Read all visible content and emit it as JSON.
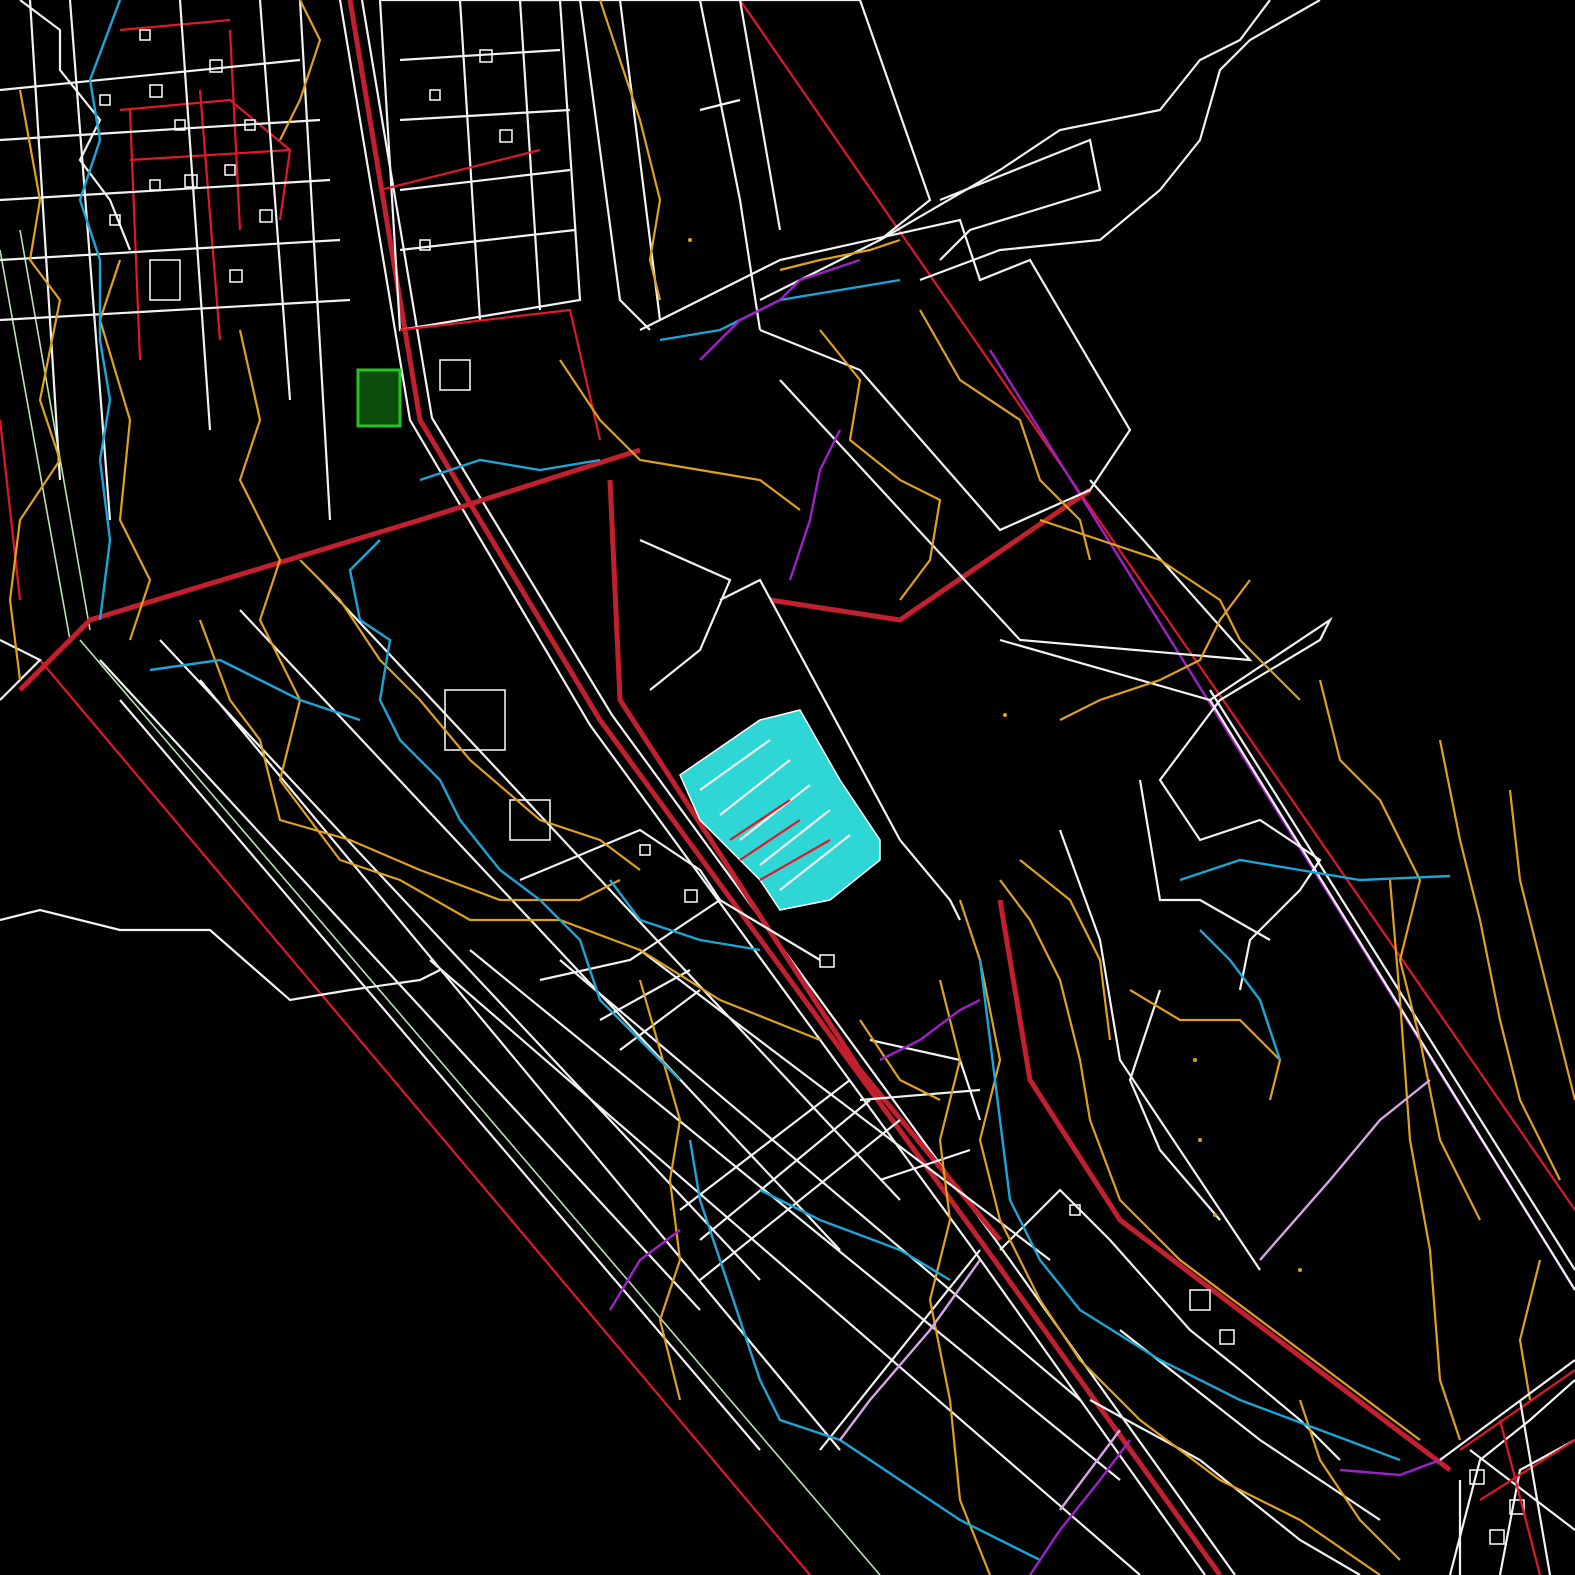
{
  "drawing": {
    "background": "#000000",
    "layer_colors": {
      "parcel_boundary": "#f2f2f2",
      "road_red": "#e0182a",
      "contour_orange": "#e0a11b",
      "water_blue": "#1aa6d8",
      "utility_purple": "#a020c8",
      "utility_light_purple": "#d9a4e8",
      "edge_green": "#b7e3b0",
      "highlight_cyan": "#2fd6d6",
      "field_green": "#0b4d0b"
    }
  }
}
